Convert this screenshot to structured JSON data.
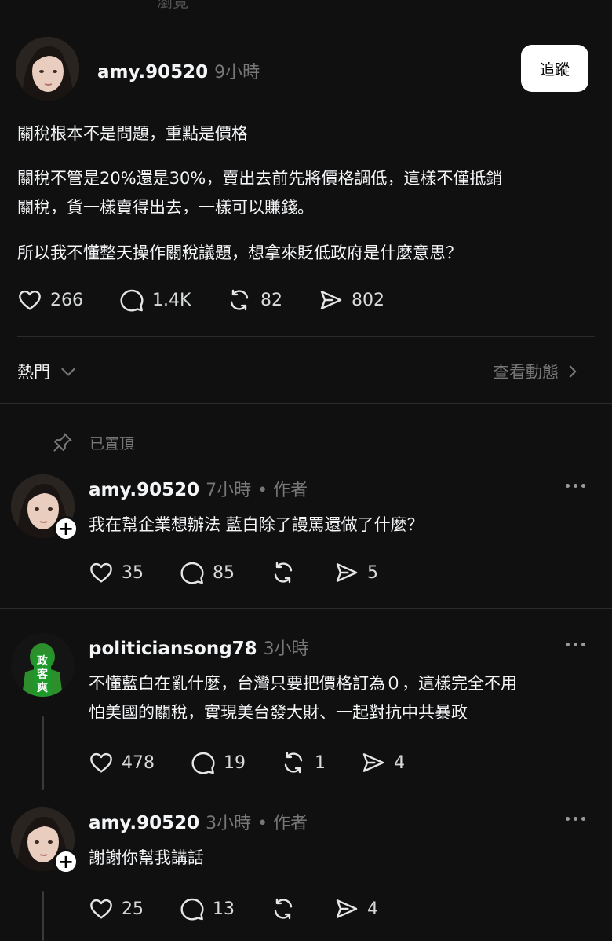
{
  "header_fragment": "瀏覽",
  "post": {
    "username": "amy.90520",
    "time": "9小時",
    "follow_label": "追蹤",
    "lines": [
      "關稅根本不是問題，重點是價格",
      "關稅不管是20%還是30%，賣出去前先將價格調低，這樣不僅抵銷",
      "關稅，貨一樣賣得出去，一樣可以賺錢。",
      "所以我不懂整天操作關稅議題，想拿來貶低政府是什麼意思？"
    ],
    "likes": "266",
    "comments": "1.4K",
    "reposts": "82",
    "shares": "802"
  },
  "sort": {
    "label": "熱門",
    "activity_link": "查看動態"
  },
  "pinned_label": "已置頂",
  "replies": [
    {
      "username": "amy.90520",
      "time": "7小時",
      "author_tag": "• 作者",
      "lines": [
        "我在幫企業想辦法 藍白除了謾罵還做了什麼？"
      ],
      "likes": "35",
      "comments": "85",
      "reposts": "",
      "shares": "5"
    },
    {
      "username": "politiciansong78",
      "time": "3小時",
      "author_tag": "",
      "avatar_text": [
        "政",
        "客",
        "爽"
      ],
      "lines": [
        "不懂藍白在亂什麼，台灣只要把價格訂為０，這樣完全不用",
        "怕美國的關稅，實現美台發大財、一起對抗中共暴政"
      ],
      "likes": "478",
      "comments": "19",
      "reposts": "1",
      "shares": "4"
    },
    {
      "username": "amy.90520",
      "time": "3小時",
      "author_tag": "• 作者",
      "lines": [
        "謝謝你幫我講話"
      ],
      "likes": "25",
      "comments": "13",
      "reposts": "",
      "shares": "4"
    }
  ]
}
